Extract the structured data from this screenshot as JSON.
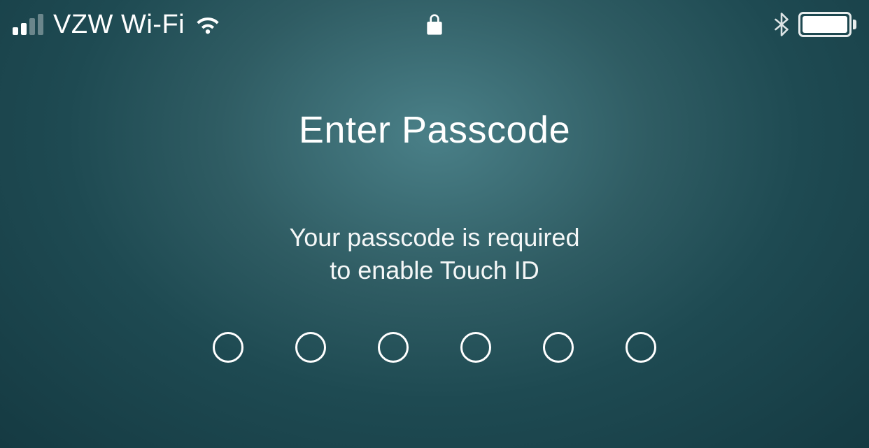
{
  "statusBar": {
    "carrier": "VZW Wi-Fi"
  },
  "lockScreen": {
    "title": "Enter Passcode",
    "subtitleLine1": "Your passcode is required",
    "subtitleLine2": "to enable Touch ID",
    "passcodeLength": 6
  }
}
